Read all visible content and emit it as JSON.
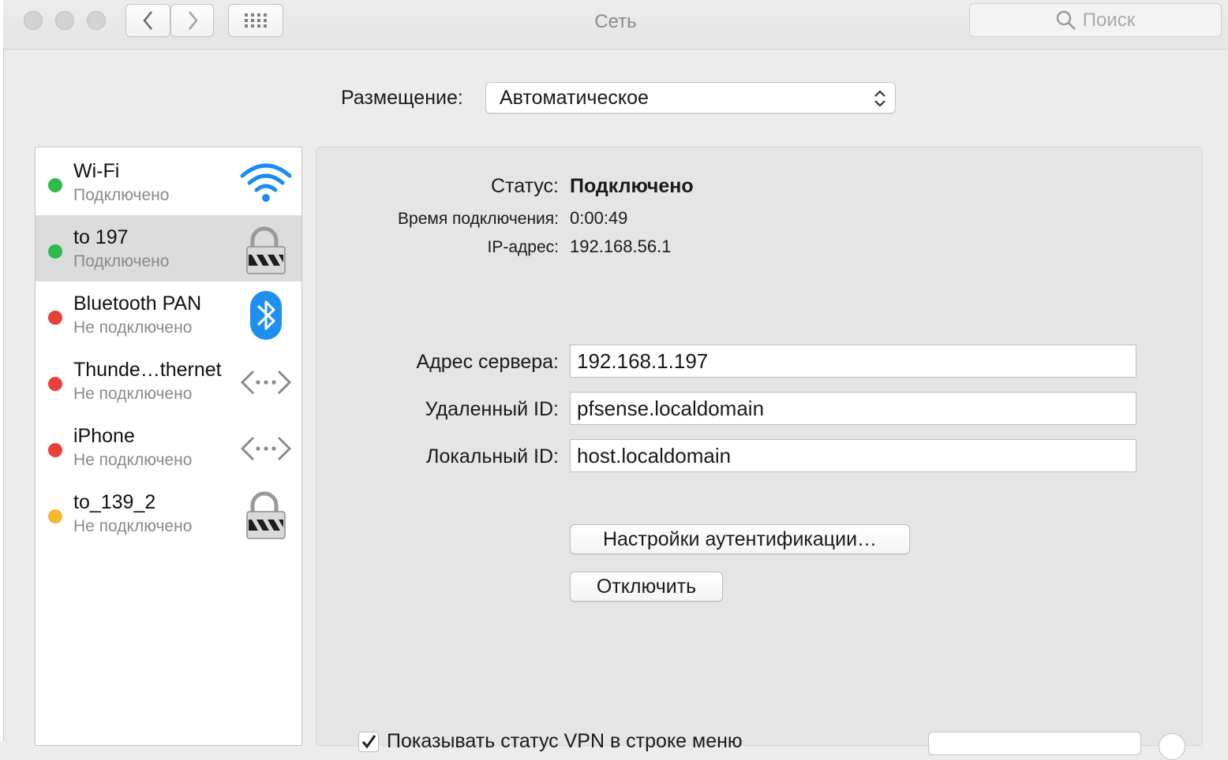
{
  "window": {
    "title": "Сеть",
    "search_placeholder": "Поиск"
  },
  "location": {
    "label": "Размещение:",
    "value": "Автоматическое"
  },
  "services": [
    {
      "name": "Wi-Fi",
      "status": "Подключено",
      "status_color": "#2cbc4a",
      "icon": "wifi-icon"
    },
    {
      "name": "to 197",
      "status": "Подключено",
      "status_color": "#2cbc4a",
      "icon": "vpn-lock-icon"
    },
    {
      "name": "Bluetooth PAN",
      "status": "Не подключено",
      "status_color": "#e8403c",
      "icon": "bluetooth-icon"
    },
    {
      "name": "Thunde…thernet",
      "status": "Не подключено",
      "status_color": "#e8403c",
      "icon": "ethernet-arrows-icon"
    },
    {
      "name": "iPhone",
      "status": "Не подключено",
      "status_color": "#e8403c",
      "icon": "ethernet-arrows-icon"
    },
    {
      "name": "to_139_2",
      "status": "Не подключено",
      "status_color": "#f7b731",
      "icon": "vpn-lock-icon"
    }
  ],
  "details": {
    "status_label": "Статус:",
    "status_value": "Подключено",
    "connect_time_label": "Время подключения:",
    "connect_time_value": "0:00:49",
    "ip_label": "IP-адрес:",
    "ip_value": "192.168.56.1",
    "server_label": "Адрес сервера:",
    "server_value": "192.168.1.197",
    "remote_id_label": "Удаленный ID:",
    "remote_id_value": "pfsense.localdomain",
    "local_id_label": "Локальный ID:",
    "local_id_value": "host.localdomain",
    "auth_button": "Настройки аутентификации…",
    "disconnect_button": "Отключить",
    "show_vpn_status_label": "Показывать статус VPN в строке меню"
  }
}
